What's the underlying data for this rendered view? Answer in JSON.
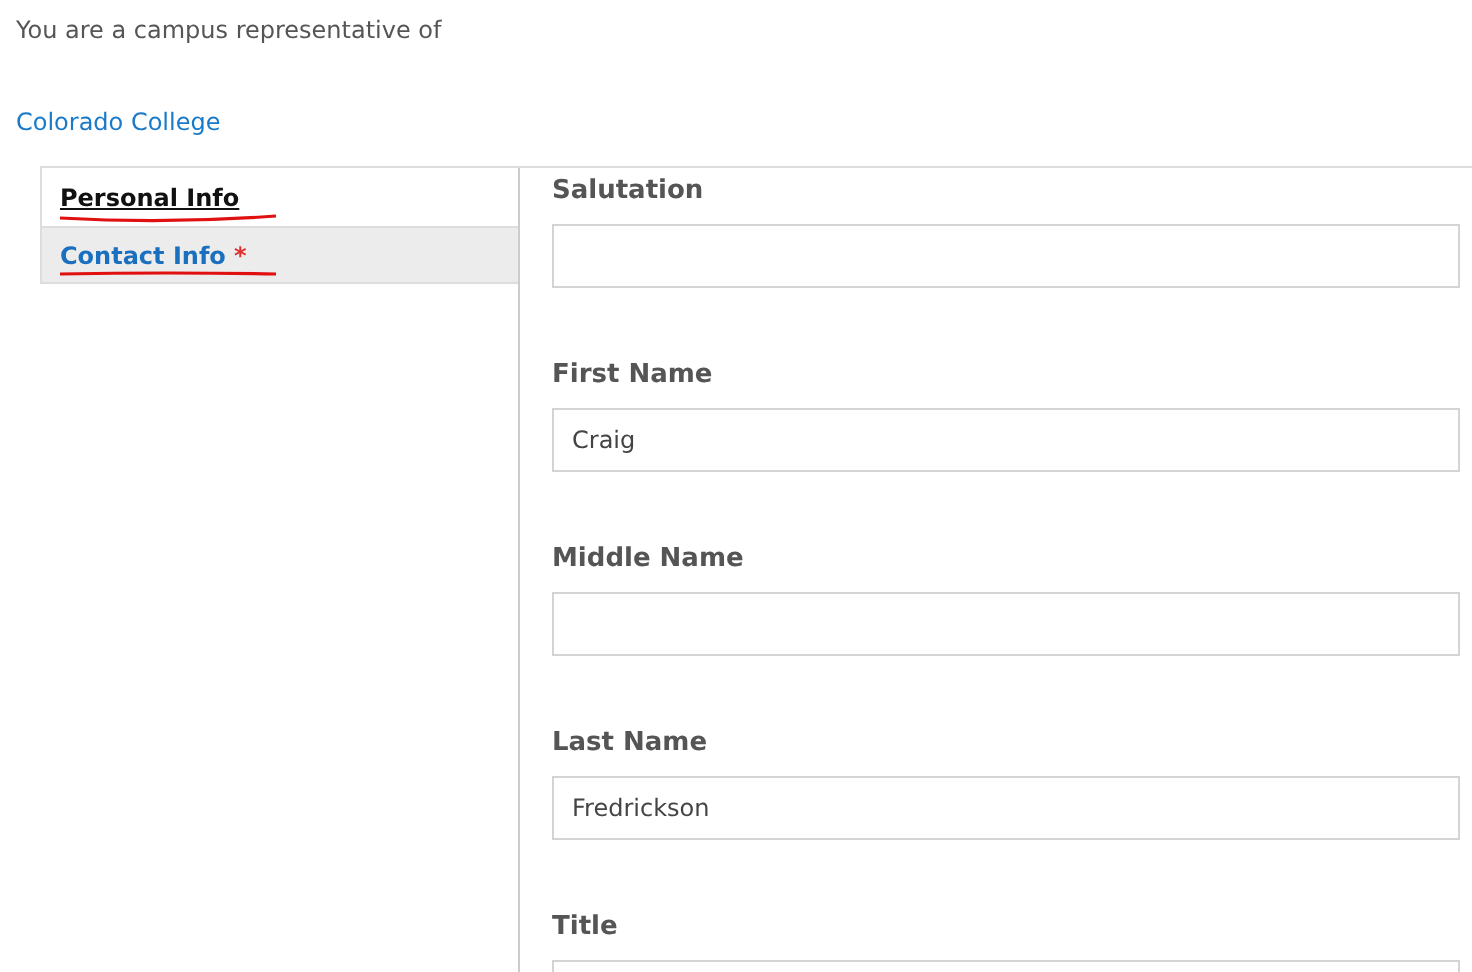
{
  "intro": "You are a campus representative of",
  "college_link": "Colorado College",
  "tabs": [
    {
      "label": "Personal Info",
      "selected": true,
      "underlined": true
    },
    {
      "label": "Contact Info",
      "selected": false,
      "underlined": true,
      "required_mark": "*"
    }
  ],
  "fields": [
    {
      "label": "Salutation"
    },
    {
      "label": "First Name",
      "value": "Craig"
    },
    {
      "label": "Middle Name"
    },
    {
      "label": "Last Name",
      "value": "Fredrickson"
    },
    {
      "label": "Title"
    }
  ]
}
